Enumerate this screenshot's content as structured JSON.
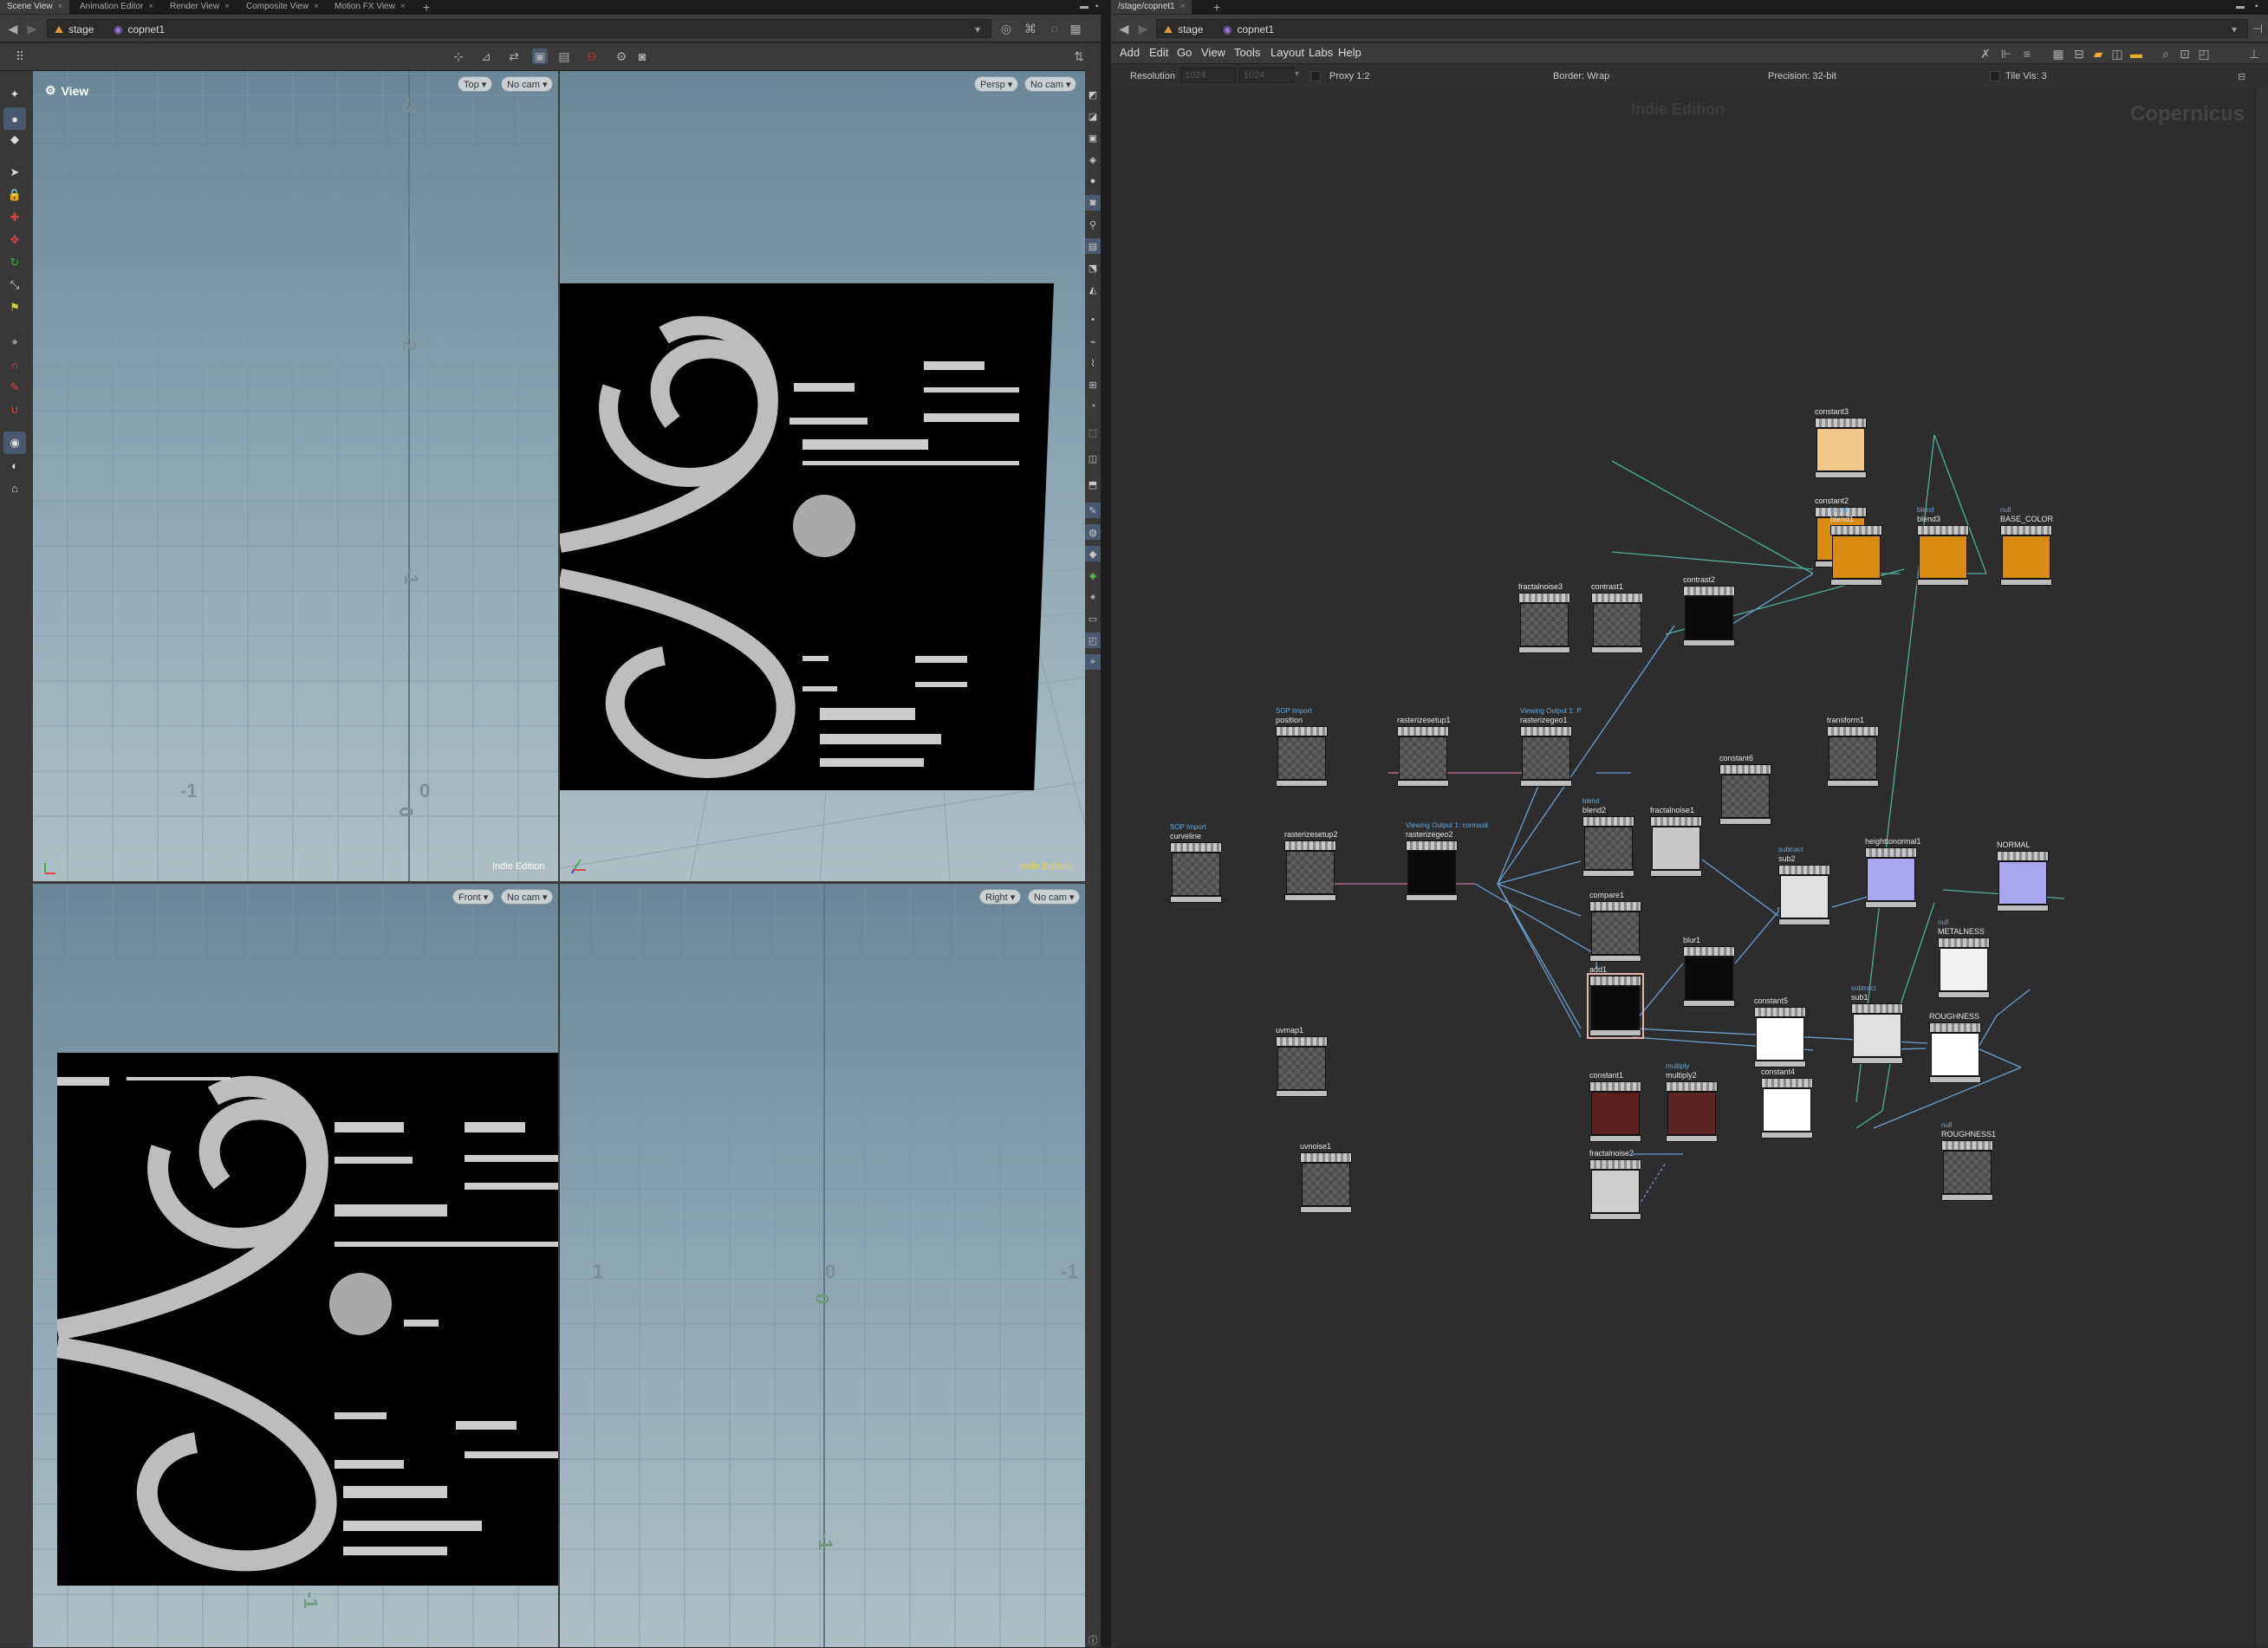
{
  "left_tabs": [
    {
      "label": "Scene View",
      "active": true
    },
    {
      "label": "Animation Editor"
    },
    {
      "label": "Render View"
    },
    {
      "label": "Composite View"
    },
    {
      "label": "Motion FX View"
    }
  ],
  "right_tabs": [
    {
      "label": "/stage/copnet1",
      "active": true
    }
  ],
  "left_path": {
    "context": "stage",
    "node": "copnet1"
  },
  "right_path": {
    "context": "stage",
    "node": "copnet1"
  },
  "viewports": {
    "top": {
      "title": "View",
      "view_btn": "Top",
      "cam_btn": "No cam",
      "grid_labels": [
        "-3",
        "-2",
        "-1",
        "-1",
        "0",
        "0"
      ],
      "edition": "Indie Edition"
    },
    "persp": {
      "view_btn": "Persp",
      "cam_btn": "No cam",
      "edition": "Indie Edition"
    },
    "front": {
      "view_btn": "Front",
      "cam_btn": "No cam",
      "grid_labels": [
        "-1"
      ]
    },
    "right": {
      "view_btn": "Right",
      "cam_btn": "No cam",
      "grid_labels": [
        "1",
        "0",
        "-1",
        "0",
        "-1"
      ]
    }
  },
  "network": {
    "menus": [
      "Add",
      "Edit",
      "Go",
      "View",
      "Tools",
      "Layout",
      "Labs",
      "Help"
    ],
    "info": {
      "resolution_label": "Resolution",
      "res_w": "1024",
      "res_h": "1024",
      "proxy": "Proxy 1:2",
      "border": "Border: Wrap",
      "precision": "Precision: 32-bit",
      "tilevis": "Tile Vis: 3"
    },
    "edition_watermark": "Indie Edition",
    "context_watermark": "Copernicus",
    "nodes": [
      {
        "name": "constant3",
        "comment": "",
        "type": "tan"
      },
      {
        "name": "constant2",
        "comment": "",
        "type": "orange"
      },
      {
        "name": "blend1",
        "comment": "blend",
        "type": "orange"
      },
      {
        "name": "blend3",
        "comment": "blend",
        "type": "orange"
      },
      {
        "name": "BASE_COLOR",
        "comment": "null",
        "type": "orange"
      },
      {
        "name": "fractalnoise3",
        "comment": "",
        "type": "checker"
      },
      {
        "name": "contrast1",
        "comment": "",
        "type": "checker"
      },
      {
        "name": "contrast2",
        "comment": "",
        "type": "dark"
      },
      {
        "name": "position",
        "comment": "SOP Import",
        "type": "checker"
      },
      {
        "name": "rasterizesetup1",
        "comment": "",
        "type": "checker"
      },
      {
        "name": "rasterizegeo1",
        "comment": "Viewing Output 1: P",
        "type": "checker"
      },
      {
        "name": "transform1",
        "comment": "",
        "type": "checker"
      },
      {
        "name": "constant6",
        "comment": "",
        "type": "checker"
      },
      {
        "name": "curveline",
        "comment": "SOP Import",
        "type": "checker"
      },
      {
        "name": "rasterizesetup2",
        "comment": "",
        "type": "checker"
      },
      {
        "name": "rasterizegeo2",
        "comment": "Viewing Output 1: cormask",
        "type": "dark"
      },
      {
        "name": "blend2",
        "comment": "blend",
        "type": "checker"
      },
      {
        "name": "fractalnoise1",
        "comment": "",
        "type": "light"
      },
      {
        "name": "sub2",
        "comment": "subtract",
        "type": "light"
      },
      {
        "name": "heighttonormal1",
        "comment": "",
        "type": "blue"
      },
      {
        "name": "NORMAL",
        "comment": "",
        "type": "blue"
      },
      {
        "name": "compare1",
        "comment": "",
        "type": "checker"
      },
      {
        "name": "METALNESS",
        "comment": "null",
        "type": "light"
      },
      {
        "name": "add1",
        "comment": "",
        "type": "dark"
      },
      {
        "name": "blur1",
        "comment": "",
        "type": "dark"
      },
      {
        "name": "constant5",
        "comment": "",
        "type": "white"
      },
      {
        "name": "sub1",
        "comment": "subtract",
        "type": "light"
      },
      {
        "name": "ROUGHNESS",
        "comment": "null",
        "type": "white"
      },
      {
        "name": "uvmap1",
        "comment": "",
        "type": "checker"
      },
      {
        "name": "constant1",
        "comment": "",
        "type": "red"
      },
      {
        "name": "multiply2",
        "comment": "multiply",
        "type": "red"
      },
      {
        "name": "constant4",
        "comment": "",
        "type": "white"
      },
      {
        "name": "uvnoise1",
        "comment": "",
        "type": "checker"
      },
      {
        "name": "fractalnoise2",
        "comment": "",
        "type": "light"
      },
      {
        "name": "ROUGHNESS1",
        "comment": "null",
        "type": "checker"
      }
    ]
  }
}
